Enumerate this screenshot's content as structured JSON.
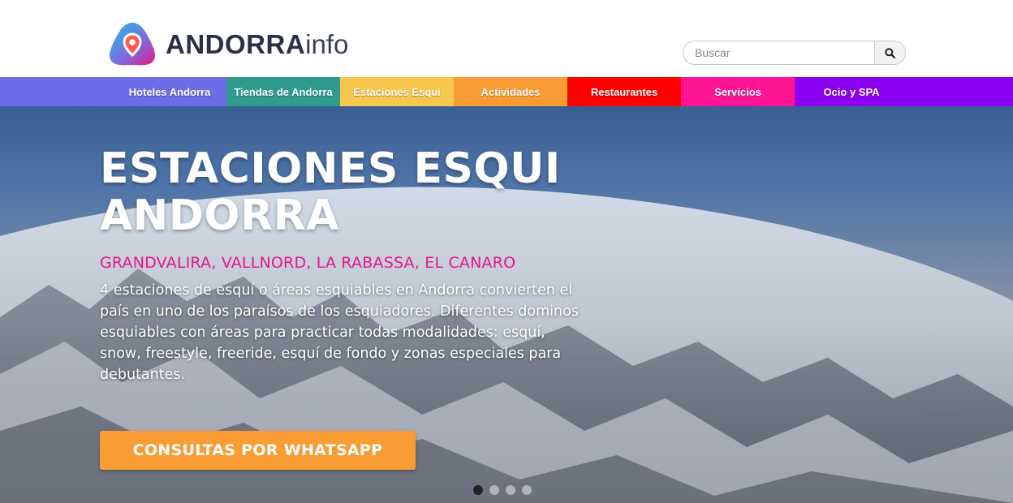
{
  "brand": {
    "name_bold": "ANDORRA",
    "name_light": "info",
    "logo_icon": "map-pin-icon",
    "colors": {
      "logo_gradient_start": "#19c3e6",
      "logo_gradient_end": "#e6178a",
      "pin": "#ff5a4e"
    }
  },
  "search": {
    "placeholder": "Buscar",
    "button_icon": "search-icon"
  },
  "nav": {
    "lead_color": "#6d6de8",
    "tail_color": "#8b00f0",
    "items": [
      {
        "label": "Hoteles Andorra",
        "color": "#6d6de8"
      },
      {
        "label": "Tiendas de Andorra",
        "color": "#2f9a8e"
      },
      {
        "label": "Estaciones Esquí",
        "color": "#f7c74d"
      },
      {
        "label": "Actividades",
        "color": "#f99c34"
      },
      {
        "label": "Restaurantes",
        "color": "#ff0000"
      },
      {
        "label": "Servicios",
        "color": "#ff1493"
      },
      {
        "label": "Ocio y SPA",
        "color": "#8b00f0"
      }
    ]
  },
  "hero": {
    "title_line1": "ESTACIONES ESQUI",
    "title_line2": "ANDORRA",
    "subtitle": "GRANDVALIRA, VALLNORD, LA RABASSA, EL CANARO",
    "description": "4 estaciones de esquí o áreas esquiables en Andorra convierten el país en uno de los paraísos de los esquiadores. Diferentes dominos esquiables con áreas para practicar todas modalidades: esquí, snow, freestyle, freeride, esquí de fondo y zonas especiales para debutantes.",
    "cta_label": "CONSULTAS POR WHATSAPP",
    "cta_color": "#f99c34",
    "subtitle_color": "#e6178a"
  },
  "carousel": {
    "slide_count": 4,
    "active_index": 0
  }
}
